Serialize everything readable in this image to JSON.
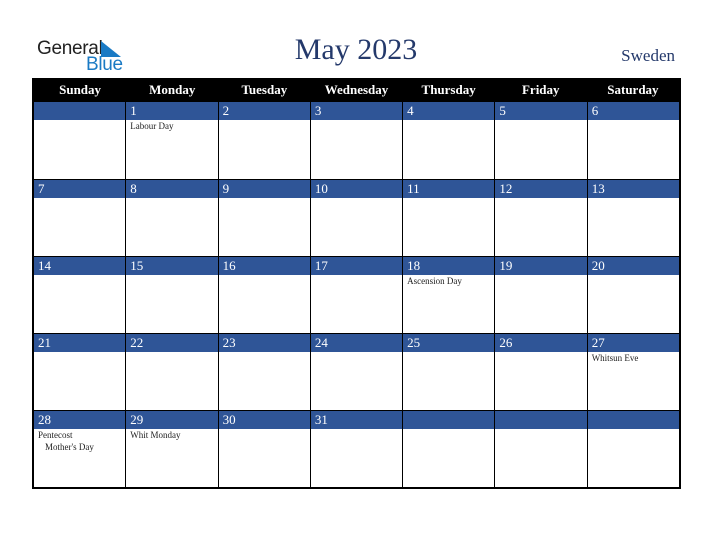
{
  "logo": {
    "word1": "General",
    "word2": "Blue"
  },
  "title": "May 2023",
  "country": "Sweden",
  "colors": {
    "header_bg": "#000000",
    "band": "#2f5597",
    "title": "#24396b",
    "logo_blue": "#1a7ac4"
  },
  "weekdays": [
    "Sunday",
    "Monday",
    "Tuesday",
    "Wednesday",
    "Thursday",
    "Friday",
    "Saturday"
  ],
  "weeks": [
    [
      {
        "day": "",
        "events": []
      },
      {
        "day": "1",
        "events": [
          "Labour Day"
        ]
      },
      {
        "day": "2",
        "events": []
      },
      {
        "day": "3",
        "events": []
      },
      {
        "day": "4",
        "events": []
      },
      {
        "day": "5",
        "events": []
      },
      {
        "day": "6",
        "events": []
      }
    ],
    [
      {
        "day": "7",
        "events": []
      },
      {
        "day": "8",
        "events": []
      },
      {
        "day": "9",
        "events": []
      },
      {
        "day": "10",
        "events": []
      },
      {
        "day": "11",
        "events": []
      },
      {
        "day": "12",
        "events": []
      },
      {
        "day": "13",
        "events": []
      }
    ],
    [
      {
        "day": "14",
        "events": []
      },
      {
        "day": "15",
        "events": []
      },
      {
        "day": "16",
        "events": []
      },
      {
        "day": "17",
        "events": []
      },
      {
        "day": "18",
        "events": [
          "Ascension Day"
        ]
      },
      {
        "day": "19",
        "events": []
      },
      {
        "day": "20",
        "events": []
      }
    ],
    [
      {
        "day": "21",
        "events": []
      },
      {
        "day": "22",
        "events": []
      },
      {
        "day": "23",
        "events": []
      },
      {
        "day": "24",
        "events": []
      },
      {
        "day": "25",
        "events": []
      },
      {
        "day": "26",
        "events": []
      },
      {
        "day": "27",
        "events": [
          "Whitsun Eve"
        ]
      }
    ],
    [
      {
        "day": "28",
        "events": [
          "Pentecost",
          "Mother's Day"
        ]
      },
      {
        "day": "29",
        "events": [
          "Whit Monday"
        ]
      },
      {
        "day": "30",
        "events": []
      },
      {
        "day": "31",
        "events": []
      },
      {
        "day": "",
        "events": []
      },
      {
        "day": "",
        "events": []
      },
      {
        "day": "",
        "events": []
      }
    ]
  ]
}
